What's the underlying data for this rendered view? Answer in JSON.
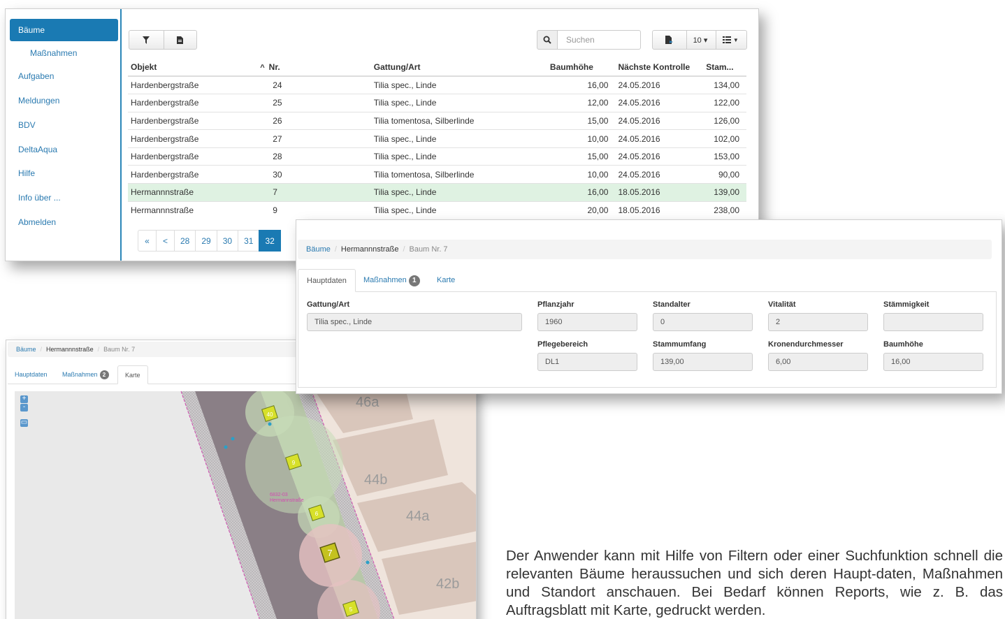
{
  "sidebar": {
    "items": [
      {
        "label": "Bäume"
      },
      {
        "label": "Maßnahmen"
      },
      {
        "label": "Aufgaben"
      },
      {
        "label": "Meldungen"
      },
      {
        "label": "BDV"
      },
      {
        "label": "DeltaAqua"
      },
      {
        "label": "Hilfe"
      },
      {
        "label": "Info über ..."
      },
      {
        "label": "Abmelden"
      }
    ]
  },
  "toolbar": {
    "search_placeholder": "Suchen",
    "page_size": "10 ▾",
    "filter_icon": "filter-icon",
    "export_icon": "file-icon"
  },
  "table": {
    "headers": [
      "Objekt",
      "Nr.",
      "Gattung/Art",
      "Baumhöhe",
      "Nächste Kontrolle",
      "Stam..."
    ],
    "sort_indicator": "^",
    "rows": [
      [
        "Hardenbergstraße",
        "24",
        "Tilia spec., Linde",
        "16,00",
        "24.05.2016",
        "134,00"
      ],
      [
        "Hardenbergstraße",
        "25",
        "Tilia spec., Linde",
        "12,00",
        "24.05.2016",
        "122,00"
      ],
      [
        "Hardenbergstraße",
        "26",
        "Tilia tomentosa, Silberlinde",
        "15,00",
        "24.05.2016",
        "126,00"
      ],
      [
        "Hardenbergstraße",
        "27",
        "Tilia spec., Linde",
        "10,00",
        "24.05.2016",
        "102,00"
      ],
      [
        "Hardenbergstraße",
        "28",
        "Tilia spec., Linde",
        "15,00",
        "24.05.2016",
        "153,00"
      ],
      [
        "Hardenbergstraße",
        "30",
        "Tilia tomentosa, Silberlinde",
        "10,00",
        "24.05.2016",
        "90,00"
      ],
      [
        "Hermannnstraße",
        "7",
        "Tilia spec., Linde",
        "16,00",
        "18.05.2016",
        "139,00"
      ],
      [
        "Hermannnstraße",
        "9",
        "Tilia spec., Linde",
        "20,00",
        "18.05.2016",
        "238,00"
      ]
    ]
  },
  "pager": [
    "«",
    "<",
    "28",
    "29",
    "30",
    "31",
    "32"
  ],
  "detail": {
    "breadcrumb": [
      "Bäume",
      "Hermannnstraße",
      "Baum Nr. 7"
    ],
    "tabs": [
      "Hauptdaten",
      "Maßnahmen",
      "Karte"
    ],
    "measures_count": "1",
    "fields_row1": [
      {
        "label": "Gattung/Art",
        "value": "Tilia spec., Linde"
      },
      {
        "label": "Pflanzjahr",
        "value": "1960"
      },
      {
        "label": "Standalter",
        "value": "0"
      },
      {
        "label": "Vitalität",
        "value": "2"
      },
      {
        "label": "Stämmigkeit",
        "value": ""
      }
    ],
    "fields_row2": [
      {
        "label": "Pflegebereich",
        "value": "DL1"
      },
      {
        "label": "Stammumfang",
        "value": "139,00"
      },
      {
        "label": "Kronendurchmesser",
        "value": "6,00"
      },
      {
        "label": "Baumhöhe",
        "value": "16,00"
      }
    ]
  },
  "map_view": {
    "breadcrumb": [
      "Bäume",
      "Hermannnstraße",
      "Baum Nr. 7"
    ],
    "tabs": [
      "Hauptdaten",
      "Maßnahmen",
      "Karte"
    ],
    "measures_count": "2",
    "zoom_in": "+",
    "zoom_out": "-",
    "house_numbers": [
      "46a",
      "44b",
      "44a",
      "42b"
    ],
    "street_label_code": "6832-03",
    "street_label_name": "Hermannstraße",
    "tree_numbers": [
      "40",
      "9",
      "6",
      "7",
      "5"
    ]
  },
  "caption": "Der Anwender kann mit Hilfe von Filtern oder einer Suchfunktion schnell die relevanten Bäume heraussuchen und sich deren Haupt-daten, Maßnahmen und Standort anschauen. Bei Bedarf können Reports, wie z. B. das Auftragsblatt mit Karte, gedruckt werden."
}
